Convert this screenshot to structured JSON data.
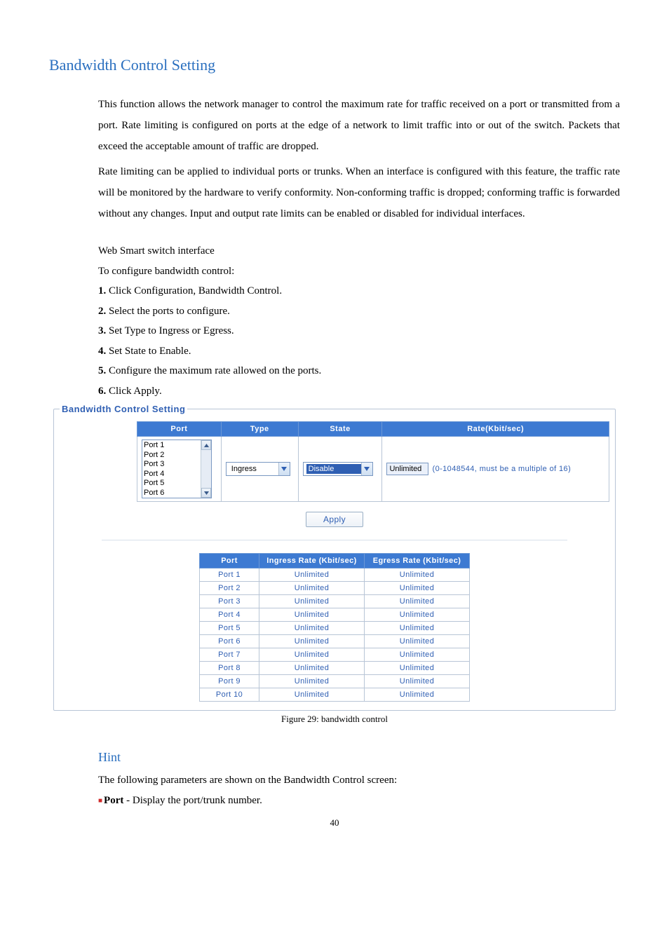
{
  "section_title": "Bandwidth Control Setting",
  "para1": "This function allows the network manager to control the maximum rate for traffic received on a port or transmitted from a port. Rate limiting is configured on ports at the edge of a network to limit traffic into or out of the switch. Packets that exceed the acceptable amount of traffic are dropped.",
  "para2": "Rate limiting can be applied to individual ports or trunks. When an interface is configured with this feature, the traffic rate will be monitored by the hardware to verify conformity. Non-conforming traffic is dropped; conforming traffic is forwarded without any changes. Input and output rate limits can be enabled or disabled for individual interfaces.",
  "wss": "Web Smart switch interface",
  "toconf": "To configure bandwidth control:",
  "steps": [
    {
      "n": "1.",
      "t": " Click Configuration, Bandwidth Control."
    },
    {
      "n": "2.",
      "t": " Select the ports to configure."
    },
    {
      "n": "3.",
      "t": " Set Type to Ingress or Egress."
    },
    {
      "n": "4.",
      "t": " Set State to Enable."
    },
    {
      "n": "5.",
      "t": " Configure the maximum rate allowed on the ports."
    },
    {
      "n": "6.",
      "t": " Click Apply."
    }
  ],
  "fieldset_legend": "Bandwidth Control Setting",
  "cfg_headers": {
    "port": "Port",
    "type": "Type",
    "state": "State",
    "rate": "Rate(Kbit/sec)"
  },
  "port_list": [
    "Port 1",
    "Port 2",
    "Port 3",
    "Port 4",
    "Port 5",
    "Port 6"
  ],
  "type_value": "Ingress",
  "state_value": "Disable",
  "rate_value": "Unlimited",
  "rate_hint": "(0-1048544, must be a multiple of 16)",
  "apply_label": "Apply",
  "rates_headers": {
    "port": "Port",
    "ingress": "Ingress Rate (Kbit/sec)",
    "egress": "Egress Rate (Kbit/sec)"
  },
  "chart_data": {
    "type": "table",
    "columns": [
      "Port",
      "Ingress Rate (Kbit/sec)",
      "Egress Rate (Kbit/sec)"
    ],
    "rows": [
      [
        "Port 1",
        "Unlimited",
        "Unlimited"
      ],
      [
        "Port 2",
        "Unlimited",
        "Unlimited"
      ],
      [
        "Port 3",
        "Unlimited",
        "Unlimited"
      ],
      [
        "Port 4",
        "Unlimited",
        "Unlimited"
      ],
      [
        "Port 5",
        "Unlimited",
        "Unlimited"
      ],
      [
        "Port 6",
        "Unlimited",
        "Unlimited"
      ],
      [
        "Port 7",
        "Unlimited",
        "Unlimited"
      ],
      [
        "Port 8",
        "Unlimited",
        "Unlimited"
      ],
      [
        "Port 9",
        "Unlimited",
        "Unlimited"
      ],
      [
        "Port 10",
        "Unlimited",
        "Unlimited"
      ]
    ]
  },
  "figure_caption": "Figure 29: bandwidth control",
  "hint_heading": "Hint",
  "hint_intro": "The following parameters are shown on the Bandwidth Control screen:",
  "bullet_term": "Port ",
  "bullet_desc": "- Display the port/trunk number.",
  "page_number": "40"
}
